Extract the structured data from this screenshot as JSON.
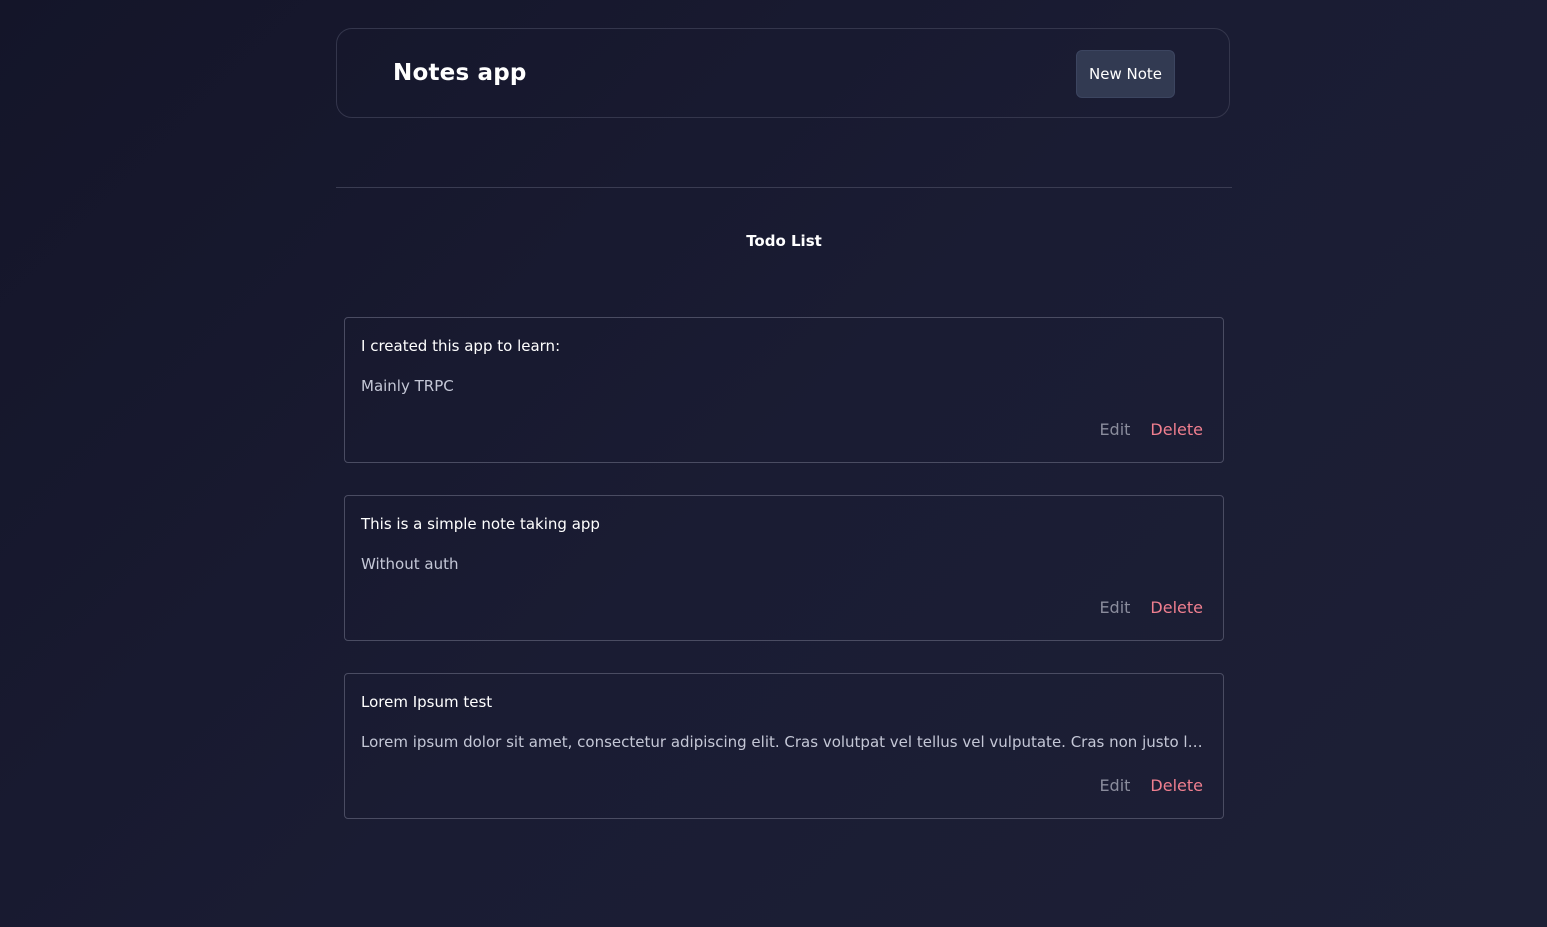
{
  "header": {
    "title": "Notes app",
    "new_note_label": "New Note"
  },
  "section": {
    "title": "Todo List"
  },
  "notes": [
    {
      "title": "I created this app to learn:",
      "body": "Mainly TRPC",
      "edit_label": "Edit",
      "delete_label": "Delete"
    },
    {
      "title": "This is a simple note taking app",
      "body": "Without auth",
      "edit_label": "Edit",
      "delete_label": "Delete"
    },
    {
      "title": "Lorem Ipsum test",
      "body": "Lorem ipsum dolor sit amet, consectetur adipiscing elit. Cras volutpat vel tellus vel vulputate. Cras non justo lectus, eget feugiat nibh. Nulla facilisi.",
      "edit_label": "Edit",
      "delete_label": "Delete"
    }
  ],
  "colors": {
    "background": "#171a2e",
    "button_bg": "#323a52",
    "delete": "#f07f8f",
    "edit": "#8a8c9c"
  }
}
